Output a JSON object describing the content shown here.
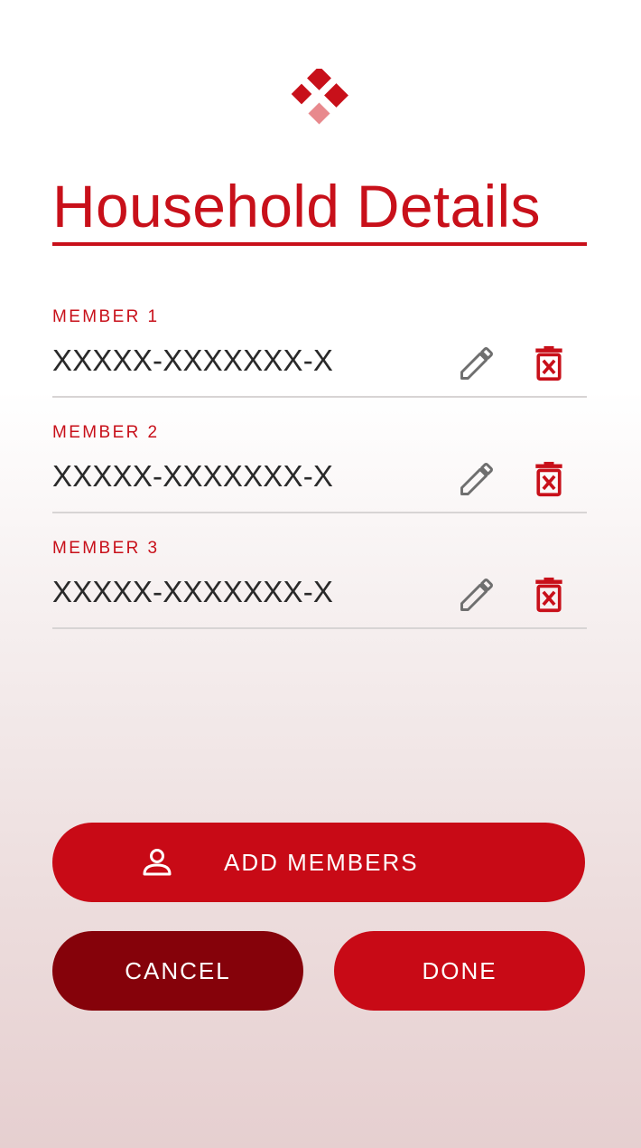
{
  "header": {
    "title": "Household Details"
  },
  "members": [
    {
      "label": "MEMBER 1",
      "id_value": "XXXXX-XXXXXXX-X"
    },
    {
      "label": "MEMBER 2",
      "id_value": "XXXXX-XXXXXXX-X"
    },
    {
      "label": "MEMBER 3",
      "id_value": "XXXXX-XXXXXXX-X"
    }
  ],
  "icons": {
    "logo": "diamond-logo-icon",
    "edit": "pencil-icon",
    "delete": "trash-icon",
    "add": "person-icon"
  },
  "actions": {
    "add_label": "ADD MEMBERS",
    "cancel_label": "CANCEL",
    "done_label": "DONE"
  },
  "colors": {
    "accent": "#c8101a",
    "button_primary": "#c80a16",
    "button_secondary": "#85020a",
    "text_dark": "#2a2a2a",
    "icon_gray": "#6f6f6f"
  }
}
